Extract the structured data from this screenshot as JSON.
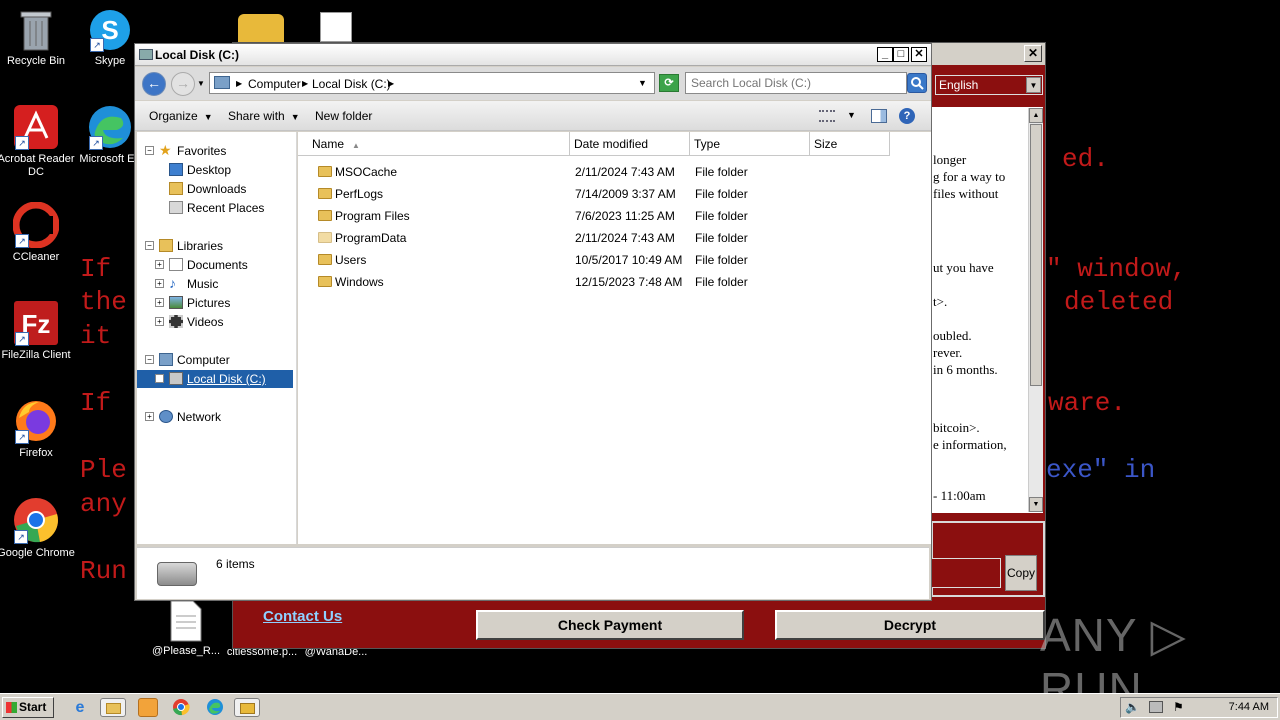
{
  "desktop": {
    "icons": [
      {
        "label": "Recycle Bin"
      },
      {
        "label": "Skype"
      },
      {
        "label": "Acrobat Reader DC"
      },
      {
        "label": "Microsoft Ed"
      },
      {
        "label": "CCleaner"
      },
      {
        "label": "FileZilla Client"
      },
      {
        "label": "Firefox"
      },
      {
        "label": "Google Chrome"
      },
      {
        "label": "@Please_R..."
      },
      {
        "label": "citiessome.p..."
      },
      {
        "label": "@WanaDe..."
      }
    ],
    "bg_lines": [
      "If",
      "the",
      "it",
      "If",
      "Ple",
      "any",
      "Run",
      "ed.",
      "\" window,",
      "deleted",
      "ware.",
      "exe\" in"
    ]
  },
  "ransom": {
    "language": "English",
    "text_lines": [
      "longer",
      "g for a way to",
      "files without",
      "ut you have",
      "t>.",
      "oubled.",
      "rever.",
      "in 6 months.",
      "bitcoin>.",
      "e information,",
      "- 11:00am"
    ],
    "copy_label": "Copy",
    "contact_label": "Contact Us",
    "check_payment_label": "Check Payment",
    "decrypt_label": "Decrypt"
  },
  "explorer": {
    "title": "Local Disk (C:)",
    "breadcrumb": [
      "Computer",
      "Local Disk (C:)"
    ],
    "search_placeholder": "Search Local Disk (C:)",
    "toolbar": {
      "organize": "Organize",
      "share_with": "Share with",
      "new_folder": "New folder"
    },
    "nav": {
      "favorites": "Favorites",
      "desktop": "Desktop",
      "downloads": "Downloads",
      "recent_places": "Recent Places",
      "libraries": "Libraries",
      "documents": "Documents",
      "music": "Music",
      "pictures": "Pictures",
      "videos": "Videos",
      "computer": "Computer",
      "local_disk": "Local Disk (C:)",
      "network": "Network"
    },
    "columns": {
      "name": "Name",
      "date_modified": "Date modified",
      "type": "Type",
      "size": "Size"
    },
    "files": [
      {
        "name": "MSOCache",
        "date": "2/11/2024 7:43 AM",
        "type": "File folder"
      },
      {
        "name": "PerfLogs",
        "date": "7/14/2009 3:37 AM",
        "type": "File folder"
      },
      {
        "name": "Program Files",
        "date": "7/6/2023 11:25 AM",
        "type": "File folder"
      },
      {
        "name": "ProgramData",
        "date": "2/11/2024 7:43 AM",
        "type": "File folder"
      },
      {
        "name": "Users",
        "date": "10/5/2017 10:49 AM",
        "type": "File folder"
      },
      {
        "name": "Windows",
        "date": "12/15/2023 7:48 AM",
        "type": "File folder"
      }
    ],
    "status": "6 items"
  },
  "taskbar": {
    "start_label": "Start",
    "clock": "7:44 AM"
  },
  "watermark": "ANY ▷ RUN"
}
